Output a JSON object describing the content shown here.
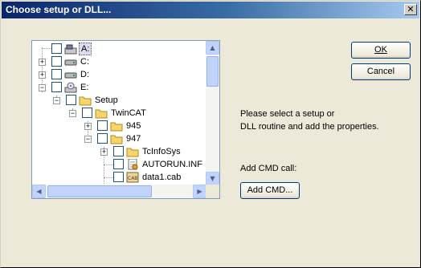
{
  "window": {
    "title": "Choose setup or DLL..."
  },
  "tree": {
    "items": [
      {
        "label": "A:",
        "icon": "floppy-drive-icon",
        "selected": true
      },
      {
        "label": "C:",
        "icon": "hard-drive-icon"
      },
      {
        "label": "D:",
        "icon": "hard-drive-icon"
      },
      {
        "label": "E:",
        "icon": "cd-drive-icon"
      },
      {
        "label": "Setup",
        "icon": "folder-icon"
      },
      {
        "label": "TwinCAT",
        "icon": "folder-icon"
      },
      {
        "label": "945",
        "icon": "folder-icon"
      },
      {
        "label": "947",
        "icon": "folder-icon"
      },
      {
        "label": "TcInfoSys",
        "icon": "folder-icon"
      },
      {
        "label": "AUTORUN.INF",
        "icon": "inf-file-icon"
      },
      {
        "label": "data1.cab",
        "icon": "cab-file-icon"
      }
    ],
    "expander_plus": "+",
    "expander_minus": "−"
  },
  "buttons": {
    "ok_label": "OK",
    "cancel_label": "Cancel",
    "add_cmd_label": "Add CMD..."
  },
  "info": {
    "line1": "Please select a setup or",
    "line2": "DLL routine and add the properties."
  },
  "cmd": {
    "label": "Add CMD call:"
  },
  "colors": {
    "title_start": "#0a246a",
    "title_end": "#a6caf0",
    "selection": "#dcdcf0",
    "dialog_bg": "#ece9d8"
  }
}
